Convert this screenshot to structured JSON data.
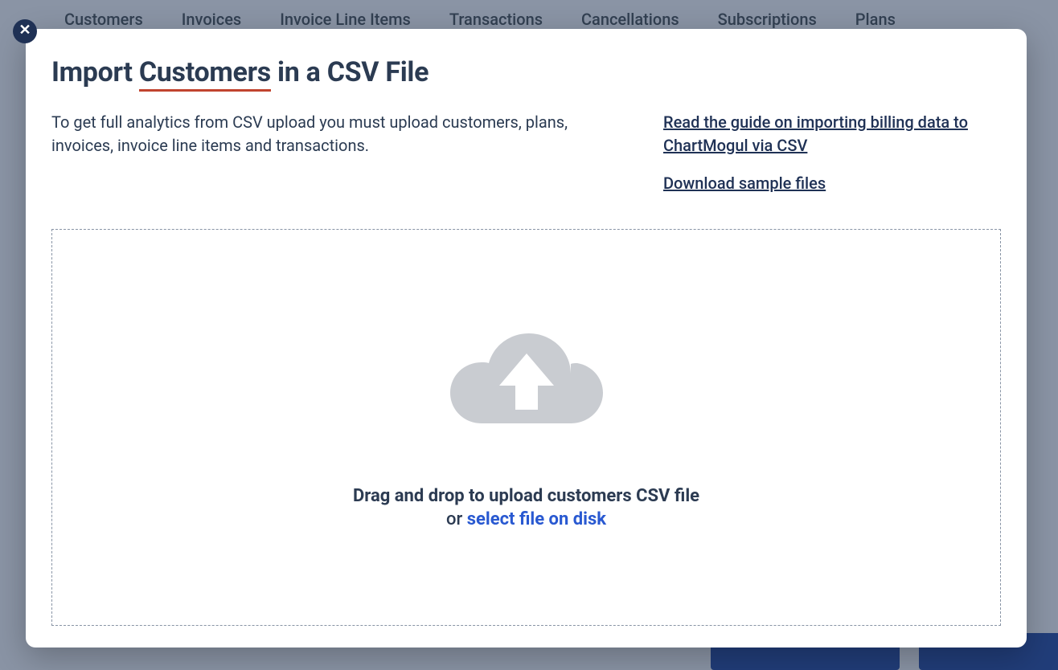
{
  "bg": {
    "tabs": [
      "Customers",
      "Invoices",
      "Invoice Line Items",
      "Transactions",
      "Cancellations",
      "Subscriptions",
      "Plans"
    ]
  },
  "modal": {
    "title_prefix": "Import ",
    "title_underlined": "Customers",
    "title_suffix": " in a CSV File",
    "info_text": "To get full analytics from CSV upload you must upload customers, plans, invoices, invoice line items and transactions.",
    "link_guide": "Read the guide on importing billing data to ChartMogul via CSV",
    "link_samples": "Download sample files",
    "drop_text": "Drag and drop to upload customers CSV file",
    "drop_or": "or ",
    "drop_select": "select file on disk"
  }
}
